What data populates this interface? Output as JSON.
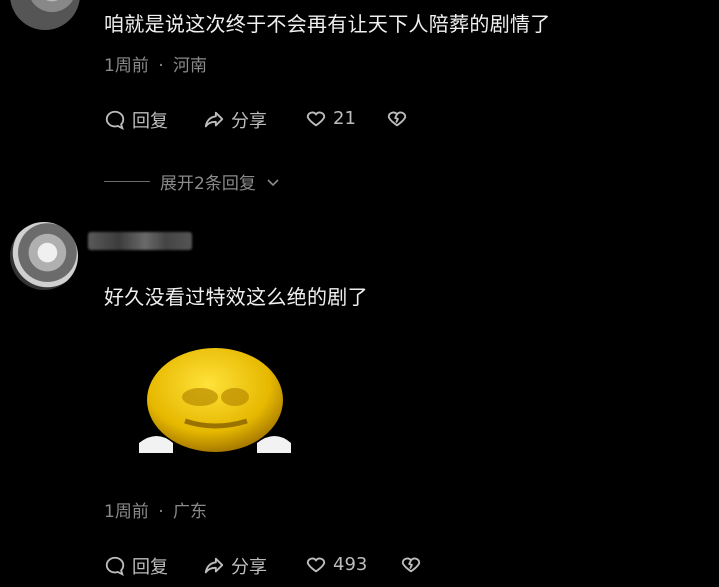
{
  "comments": [
    {
      "text": "咱就是说这次终于不会再有让天下人陪葬的剧情了",
      "time": "1周前",
      "location": "河南",
      "actions": {
        "reply": "回复",
        "share": "分享",
        "likes": "21"
      },
      "expand_label": "展开2条回复"
    },
    {
      "text": "好久没看过特效这么绝的剧了",
      "time": "1周前",
      "location": "广东",
      "actions": {
        "reply": "回复",
        "share": "分享",
        "likes": "493"
      },
      "sticker": "smiley-bowing-sticker"
    }
  ],
  "separator": "·"
}
